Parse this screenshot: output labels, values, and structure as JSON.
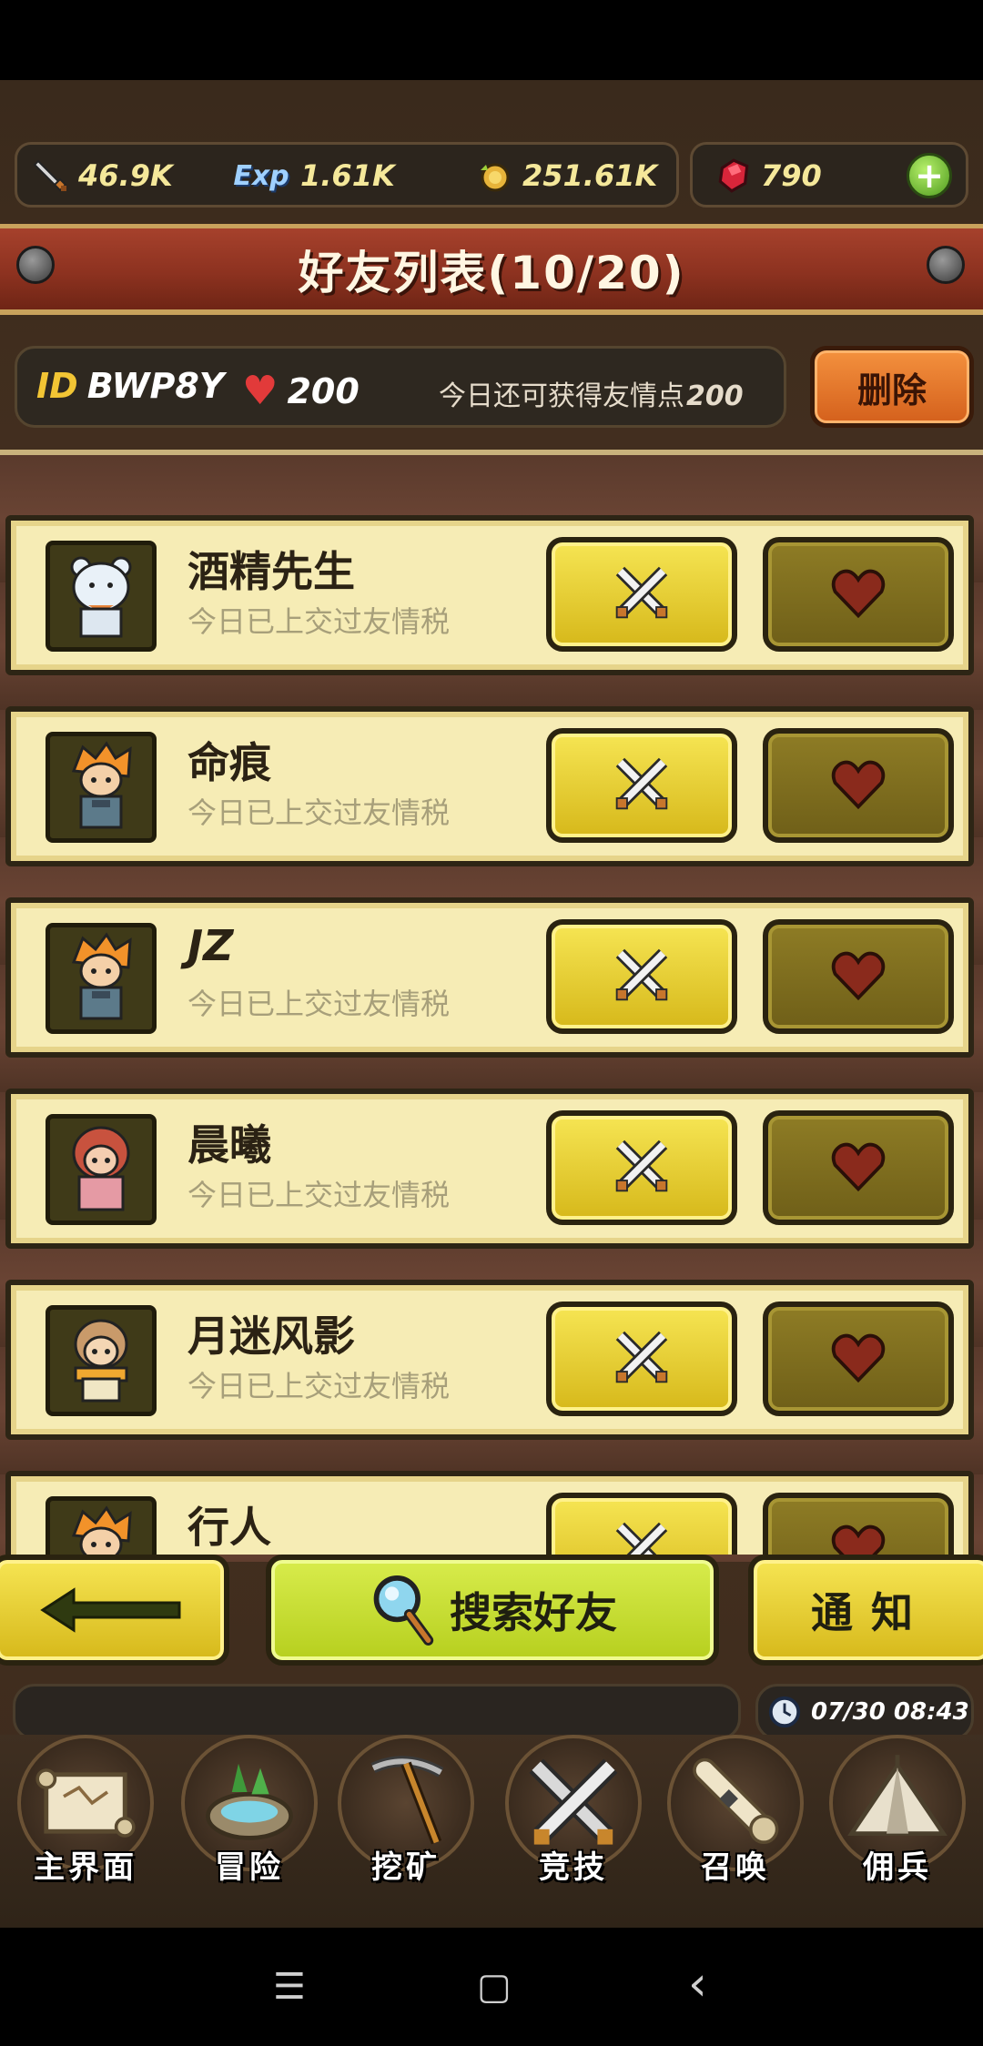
{
  "resources": {
    "attack": "46.9K",
    "exp_label": "Exp",
    "exp": "1.61K",
    "gold": "251.61K",
    "gems": "790"
  },
  "header": {
    "title": "好友列表(10/20)"
  },
  "info": {
    "id_label": "ID",
    "id_value": "BWP8Y",
    "hearts": "200",
    "note": "今日还可获得友情点",
    "note_value": "200",
    "delete_label": "删除"
  },
  "friends": [
    {
      "name": "酒精先生",
      "status": "今日已上交过友情税",
      "avatar": "bear-avatar"
    },
    {
      "name": "命痕",
      "status": "今日已上交过友情税",
      "avatar": "orange-hair-avatar"
    },
    {
      "name": "JZ",
      "status": "今日已上交过友情税",
      "avatar": "orange-hair-avatar"
    },
    {
      "name": "晨曦",
      "status": "今日已上交过友情税",
      "avatar": "red-hair-avatar"
    },
    {
      "name": "月迷风影",
      "status": "今日已上交过友情税",
      "avatar": "blonde-avatar"
    },
    {
      "name": "行人",
      "status": "",
      "avatar": "orange-hair-avatar"
    }
  ],
  "buttons": {
    "search_label": "搜索好友",
    "notify_label": "通知"
  },
  "clock": "07/30 08:43",
  "tabs": [
    {
      "label": "主界面",
      "icon": "map-scroll-icon"
    },
    {
      "label": "冒险",
      "icon": "island-icon"
    },
    {
      "label": "挖矿",
      "icon": "pickaxe-icon"
    },
    {
      "label": "竞技",
      "icon": "crossed-swords-icon"
    },
    {
      "label": "召唤",
      "icon": "summon-scroll-icon"
    },
    {
      "label": "佣兵",
      "icon": "tent-icon"
    }
  ],
  "system_nav": {
    "menu": "☰",
    "home": "▢",
    "back": "‹"
  },
  "colors": {
    "accent_yellow": "#f6e553",
    "banner_red": "#8d3220",
    "panel_cream": "#f6ecb5"
  }
}
